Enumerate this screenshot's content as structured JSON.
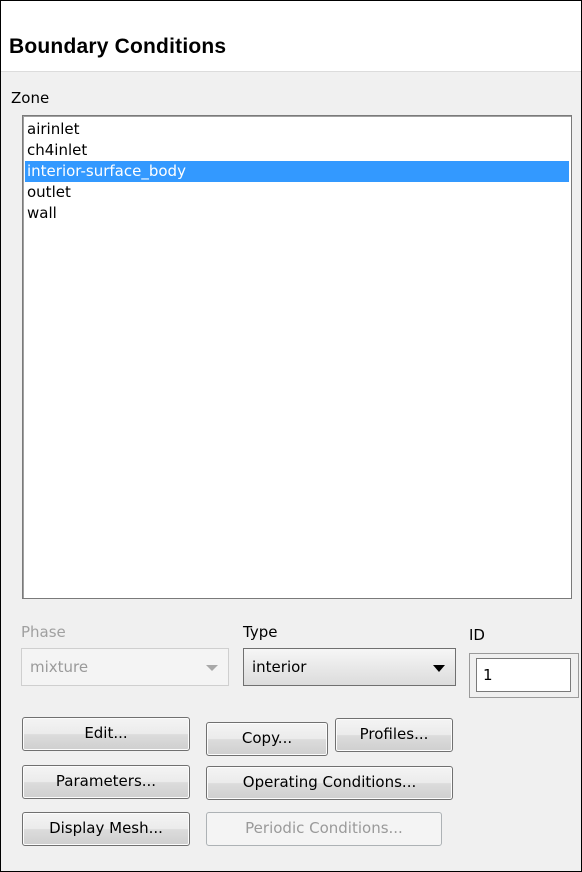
{
  "panel": {
    "title": "Boundary Conditions"
  },
  "zone": {
    "label": "Zone",
    "items": [
      "airinlet",
      "ch4inlet",
      "interior-surface_body",
      "outlet",
      "wall"
    ],
    "selected": "interior-surface_body"
  },
  "phase": {
    "label": "Phase",
    "value": "mixture"
  },
  "type": {
    "label": "Type",
    "value": "interior"
  },
  "id": {
    "label": "ID",
    "value": "1"
  },
  "buttons": {
    "edit": "Edit...",
    "copy": "Copy...",
    "profiles": "Profiles...",
    "parameters": "Parameters...",
    "operating_conditions": "Operating Conditions...",
    "display_mesh": "Display Mesh...",
    "periodic_conditions": "Periodic Conditions..."
  },
  "colors": {
    "selection": "#3399ff",
    "disabled_text": "#a0a0a0"
  }
}
